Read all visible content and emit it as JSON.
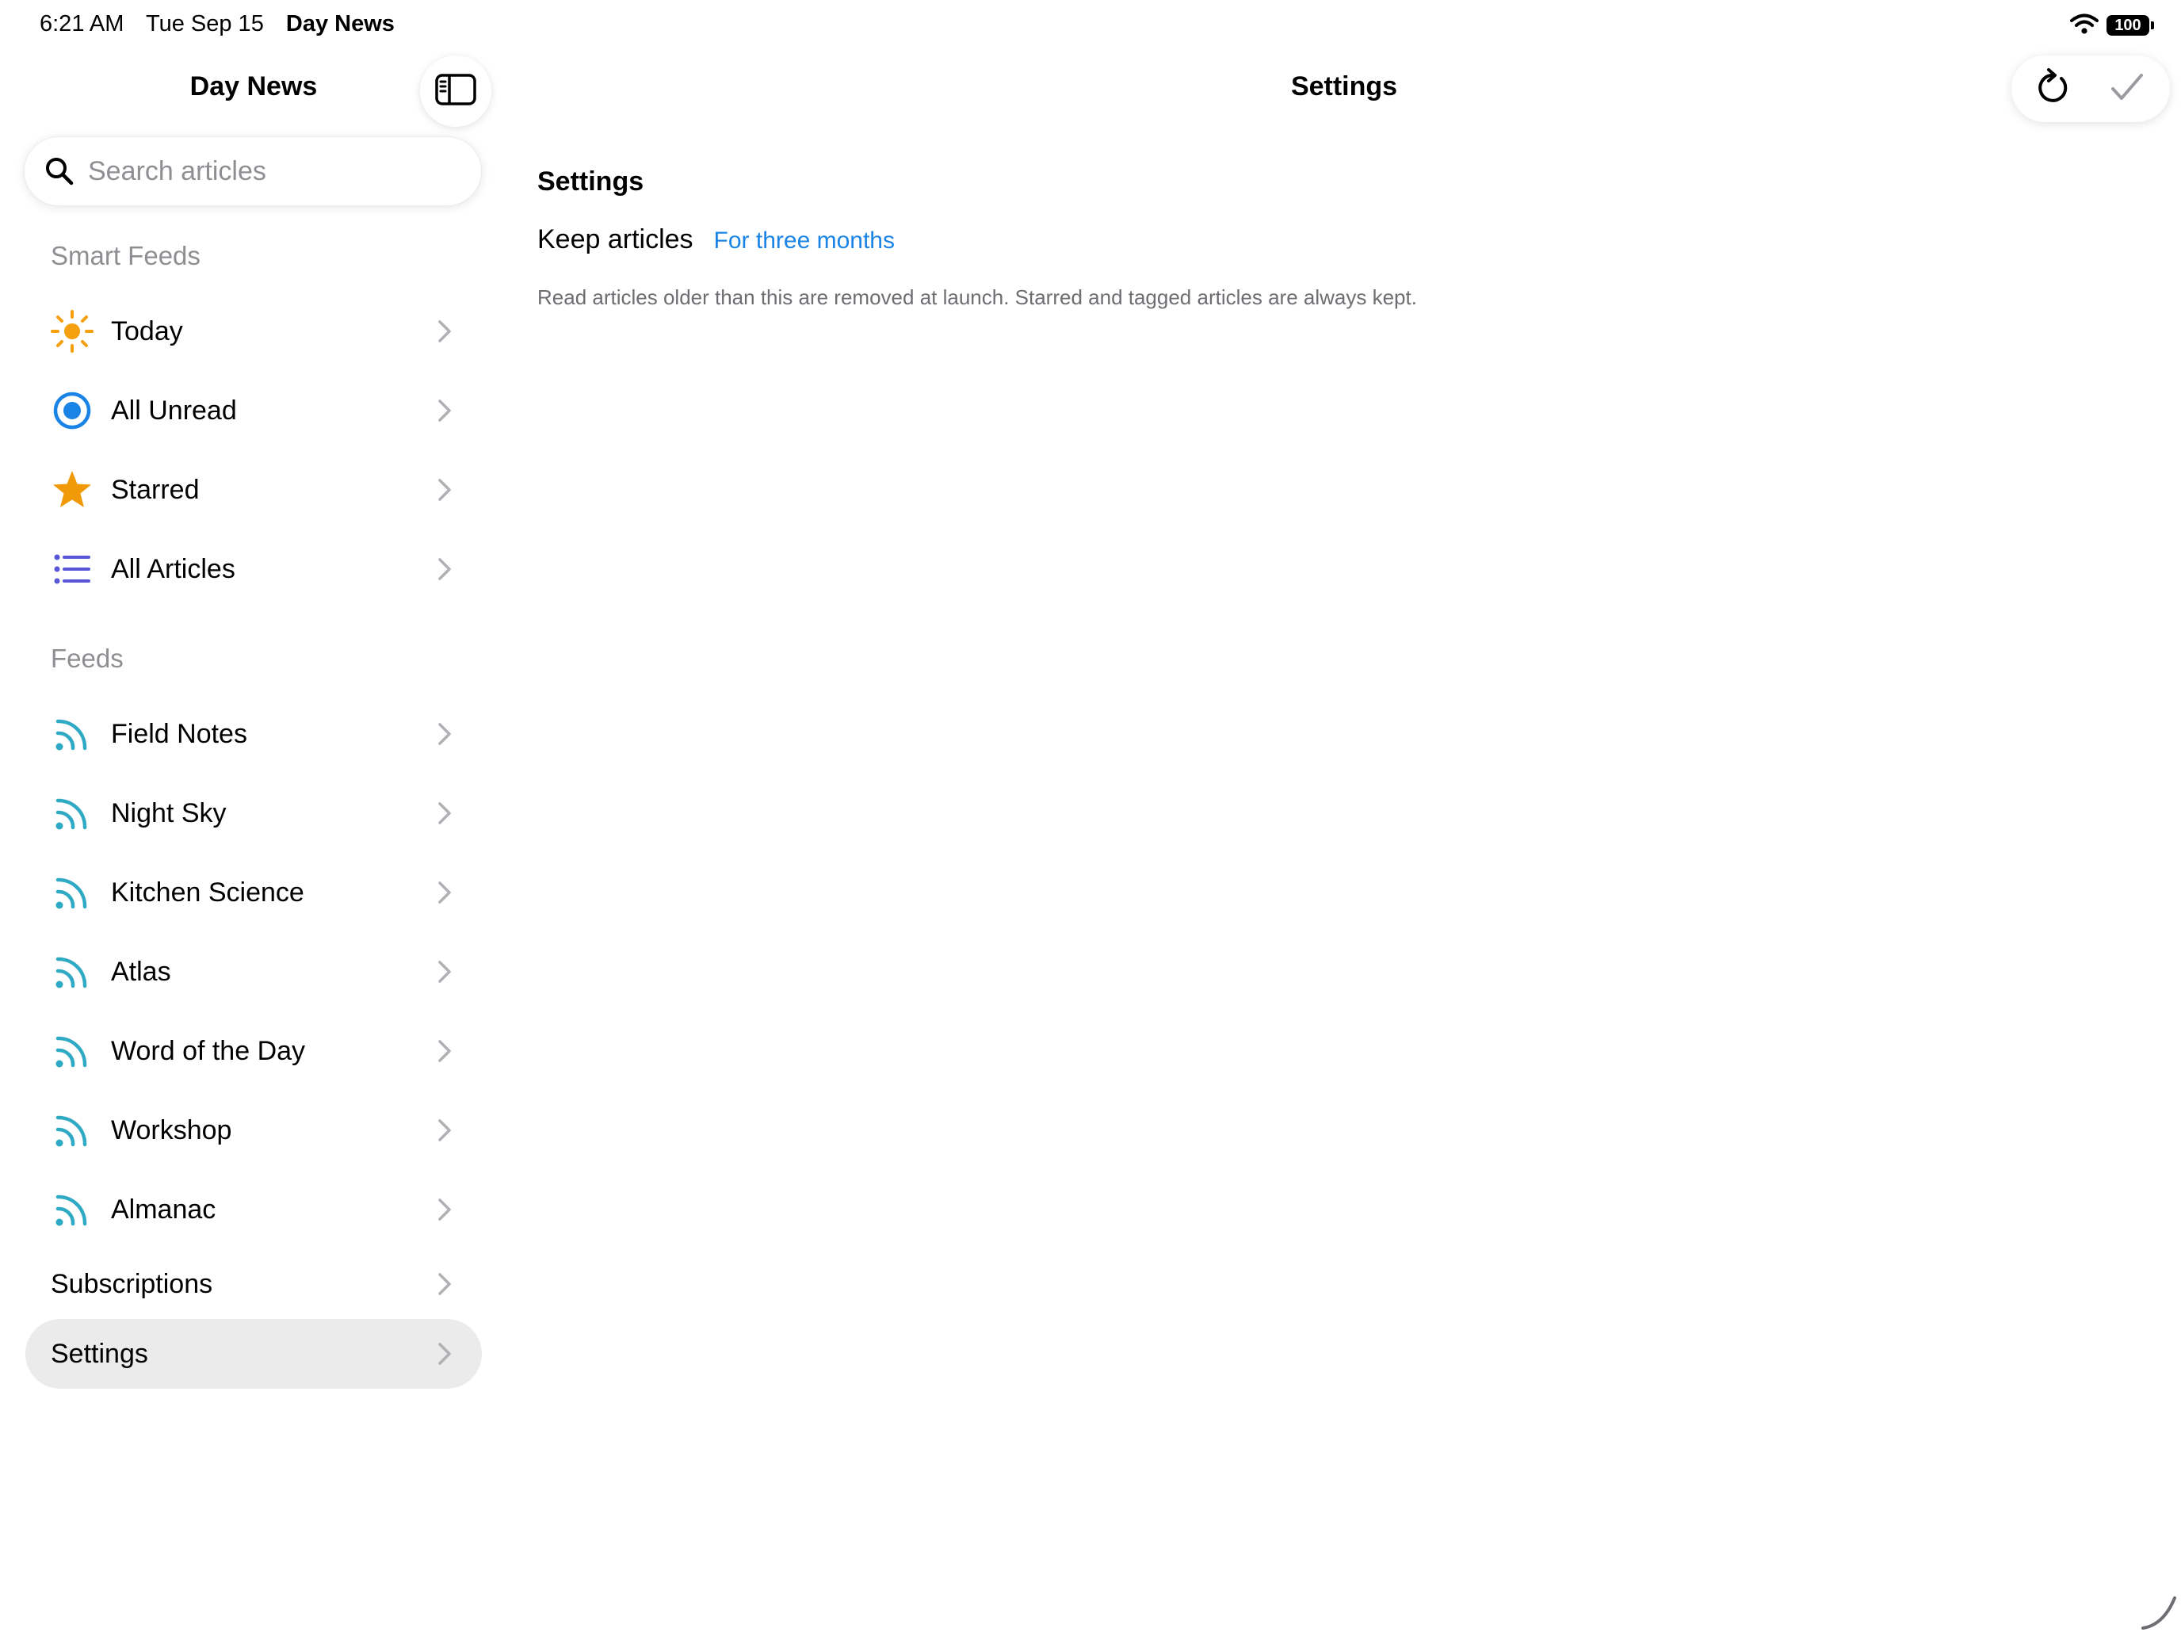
{
  "status_bar": {
    "time": "6:21 AM",
    "date": "Tue Sep 15",
    "app": "Day News",
    "battery": "100",
    "icons": [
      "wifi-icon",
      "battery-icon"
    ]
  },
  "sidebar": {
    "title": "Day News",
    "toggle_icon": "sidebar-icon",
    "search": {
      "placeholder": "Search articles",
      "value": ""
    },
    "smart_feeds": {
      "header": "Smart Feeds",
      "items": [
        {
          "label": "Today",
          "icon": "sun-icon",
          "color": "#f5a00e"
        },
        {
          "label": "All Unread",
          "icon": "unread-icon",
          "color": "#1a84e6"
        },
        {
          "label": "Starred",
          "icon": "star-icon",
          "color": "#f09a0a"
        },
        {
          "label": "All Articles",
          "icon": "list-icon",
          "color": "#5856d6"
        }
      ]
    },
    "feeds": {
      "header": "Feeds",
      "items": [
        {
          "label": "Field Notes",
          "icon": "rss-icon"
        },
        {
          "label": "Night Sky",
          "icon": "rss-icon"
        },
        {
          "label": "Kitchen Science",
          "icon": "rss-icon"
        },
        {
          "label": "Atlas",
          "icon": "rss-icon"
        },
        {
          "label": "Word of the Day",
          "icon": "rss-icon"
        },
        {
          "label": "Workshop",
          "icon": "rss-icon"
        },
        {
          "label": "Almanac",
          "icon": "rss-icon"
        }
      ],
      "feed_icon_color": "#30a9c4"
    },
    "subscriptions": {
      "label": "Subscriptions"
    },
    "settings": {
      "label": "Settings",
      "selected": true
    }
  },
  "main": {
    "title": "Settings",
    "toolbar": {
      "refresh_icon": "refresh-icon",
      "done_icon": "checkmark-icon"
    },
    "section_title": "Settings",
    "keep_articles": {
      "label": "Keep articles",
      "value": "For three months"
    },
    "note": "Read articles older than this are removed at launch. Starred and tagged articles are always kept."
  },
  "colors": {
    "accent": "#1a84e6",
    "secondary_text": "#8e8e93",
    "selected_row": "#ebebeb"
  }
}
